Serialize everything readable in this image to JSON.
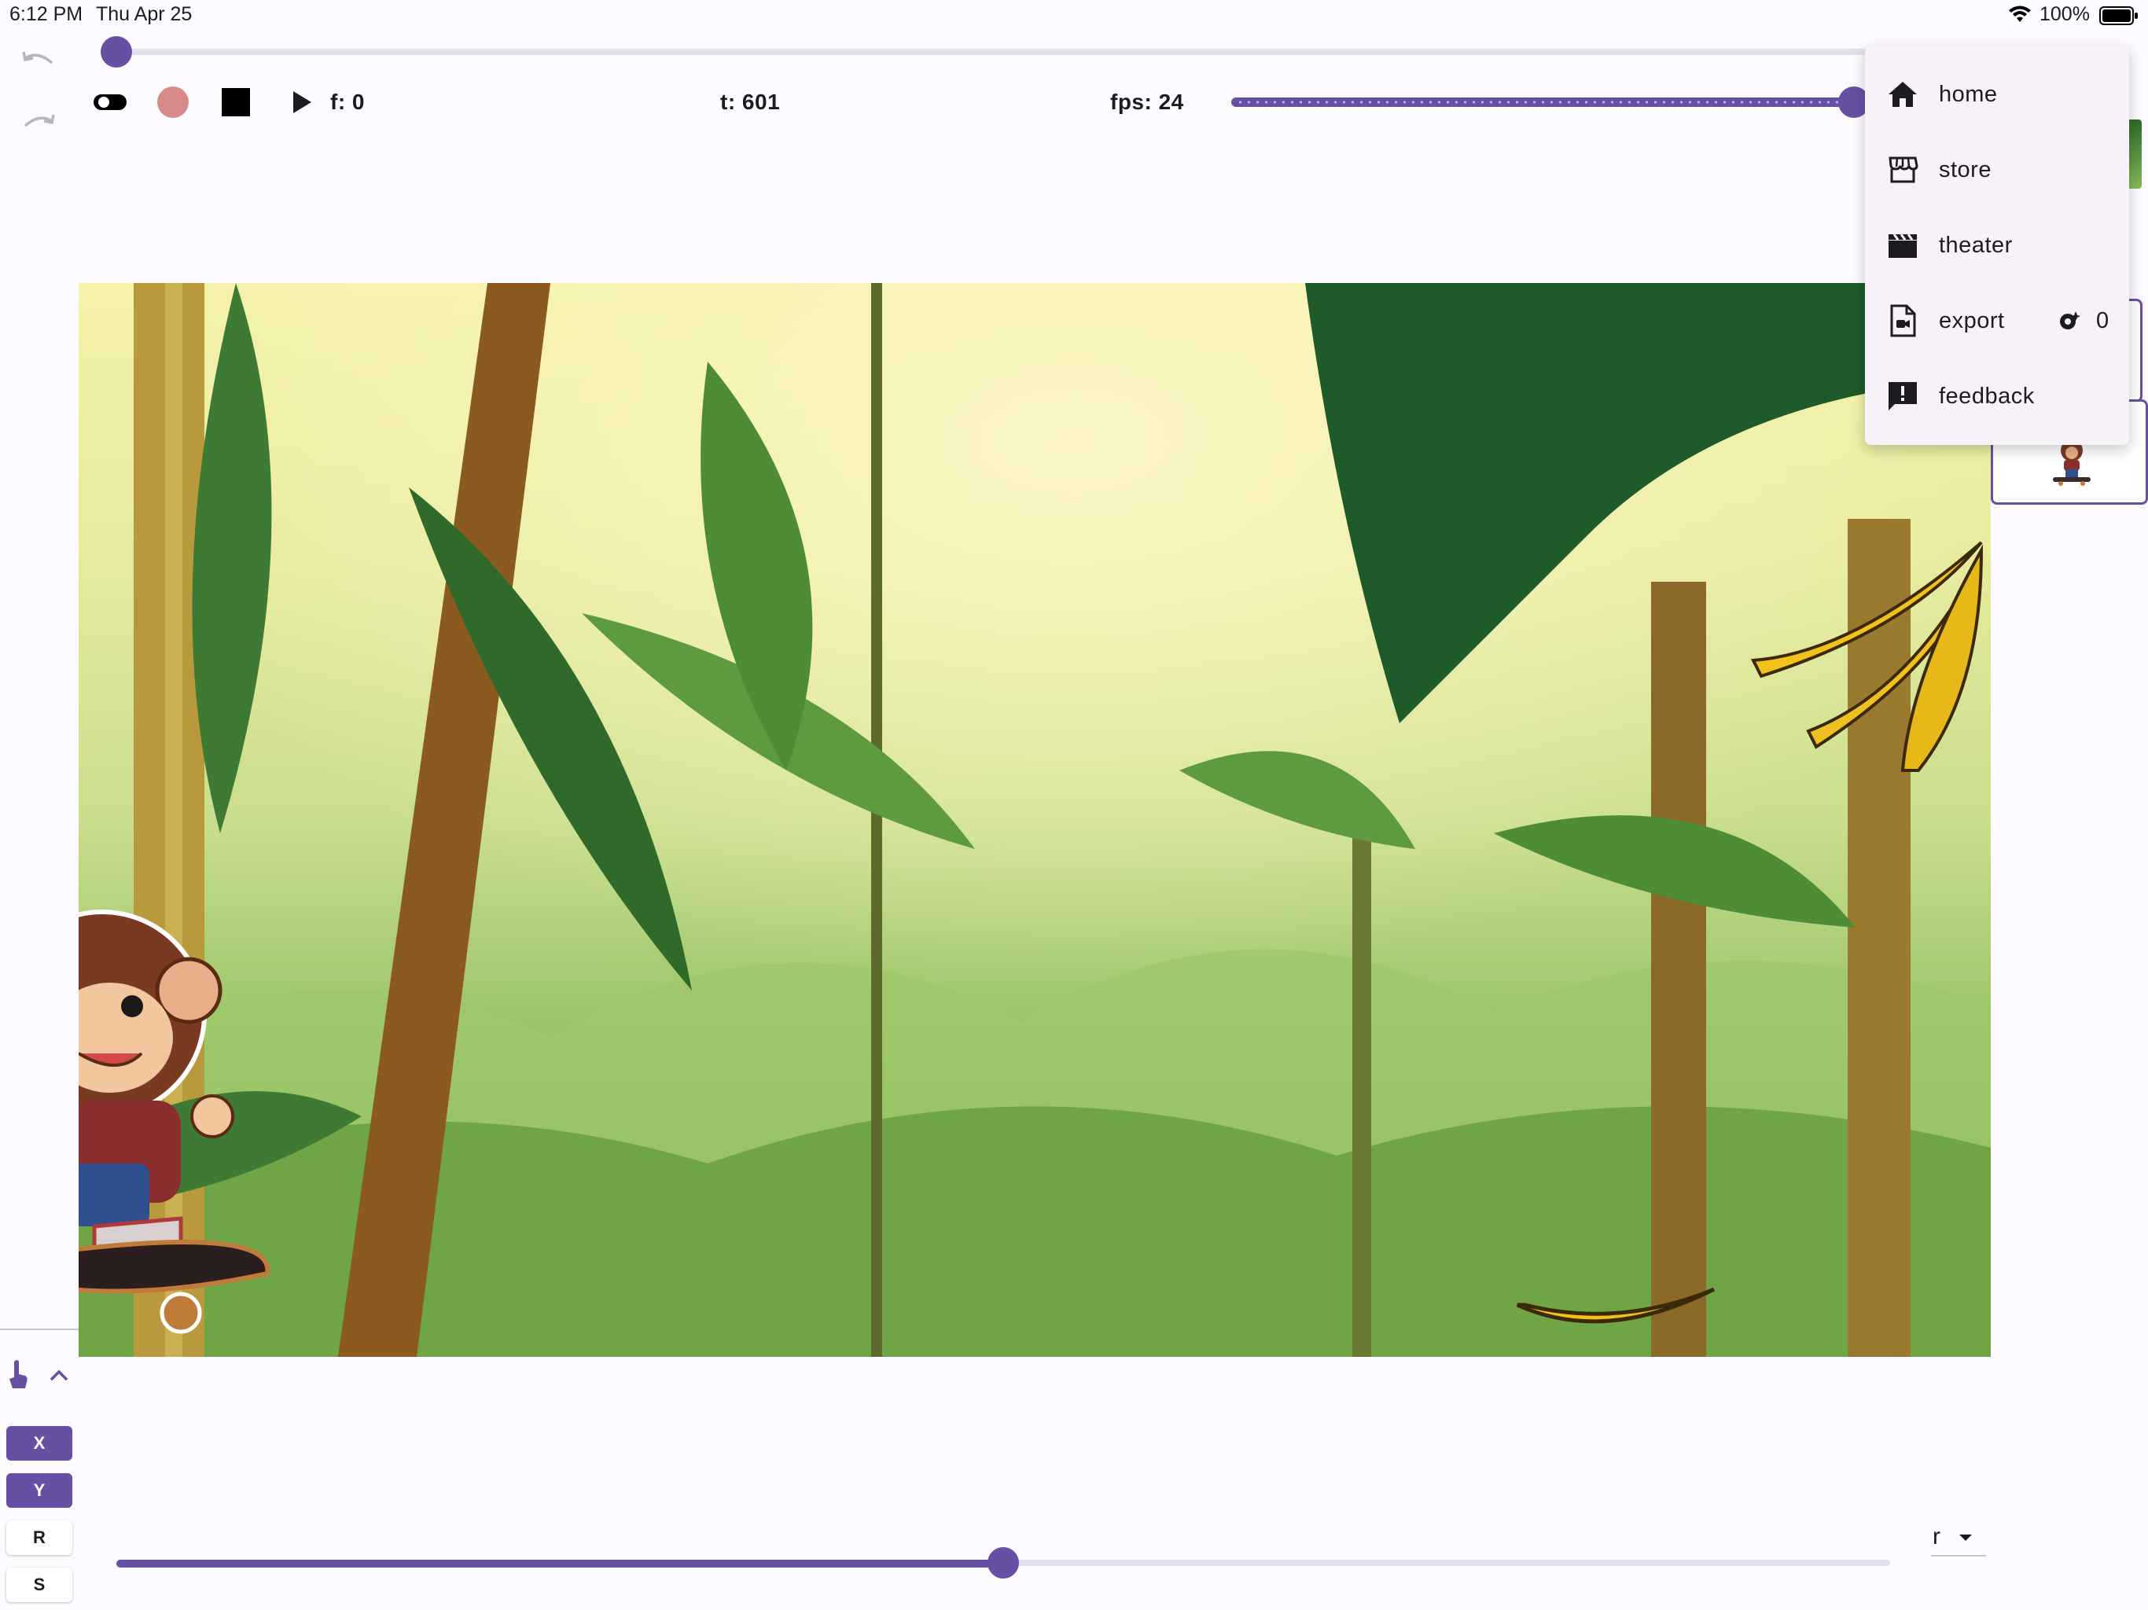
{
  "status_bar": {
    "time": "6:12 PM",
    "date": "Thu Apr 25",
    "battery": "100%"
  },
  "toolbar": {
    "frame_label": "f: 0",
    "time_label": "t: 601",
    "fps_label": "fps: 24",
    "timeline_progress": 0.0,
    "fps_slider_value": 1.0,
    "color_swatch": "#d88a8a",
    "stroke_color": "#000000"
  },
  "menu": {
    "items": [
      {
        "label": "home",
        "icon": "home-icon"
      },
      {
        "label": "store",
        "icon": "store-icon"
      },
      {
        "label": "theater",
        "icon": "clapperboard-icon"
      },
      {
        "label": "export",
        "icon": "export-video-icon",
        "badge": "0"
      },
      {
        "label": "feedback",
        "icon": "feedback-icon"
      }
    ]
  },
  "side_panel": {
    "buttons": [
      {
        "label": "X",
        "active": true
      },
      {
        "label": "Y",
        "active": true
      },
      {
        "label": "R",
        "active": false
      },
      {
        "label": "S",
        "active": false
      }
    ]
  },
  "bottom": {
    "slider_value": 0.5,
    "dropdown_value": "r"
  },
  "colors": {
    "accent": "#6750a4",
    "track": "#e4dfec"
  }
}
